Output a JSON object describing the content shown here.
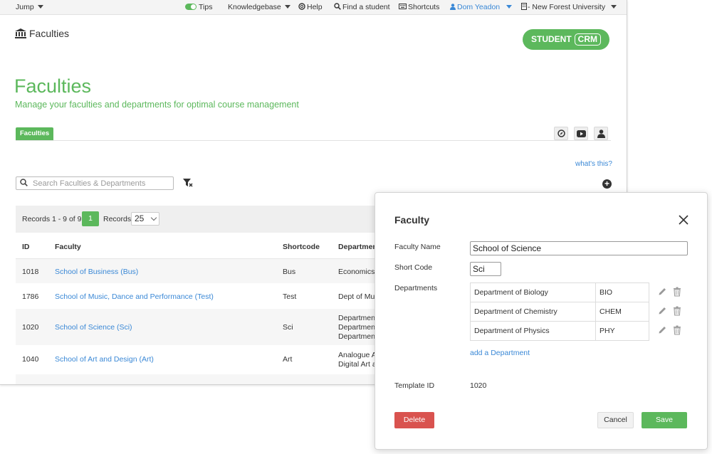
{
  "topbar": {
    "jump": "Jump",
    "tips": "Tips",
    "knowledgebase": "Knowledgebase",
    "help": "Help",
    "find_student": "Find a student",
    "shortcuts": "Shortcuts",
    "user": "Dom Yeadon",
    "institution": "- New Forest University"
  },
  "header": {
    "title": "Faculties"
  },
  "logo": {
    "student": "STUDENT",
    "crm": "CRM"
  },
  "page": {
    "title": "Faculties",
    "subtitle": "Manage your faculties and departments for optimal course management",
    "tab": "Faculties",
    "whats_this": "what's this?"
  },
  "search": {
    "placeholder": "Search Faculties & Departments"
  },
  "pager": {
    "records_text": "Records 1 - 9 of 9",
    "page": "1",
    "records_label": "Records:",
    "per_page": "25"
  },
  "table": {
    "headers": {
      "id": "ID",
      "faculty": "Faculty",
      "shortcode": "Shortcode",
      "departments": "Departmen"
    },
    "rows": [
      {
        "id": "1018",
        "faculty": "School of Business (Bus)",
        "shortcode": "Bus",
        "dept": [
          "Economics"
        ]
      },
      {
        "id": "1786",
        "faculty": "School of Music, Dance and Performance (Test)",
        "shortcode": "Test",
        "dept": [
          "Dept of Mus"
        ]
      },
      {
        "id": "1020",
        "faculty": "School of Science (Sci)",
        "shortcode": "Sci",
        "dept": [
          "Departmen",
          "Departmen",
          "Departmen"
        ]
      },
      {
        "id": "1040",
        "faculty": "School of Art and Design (Art)",
        "shortcode": "Art",
        "dept": [
          "Analogue A",
          "Digital Art a"
        ]
      }
    ]
  },
  "dialog": {
    "title": "Faculty",
    "faculty_name_label": "Faculty Name",
    "faculty_name_value": "School of Science",
    "short_code_label": "Short Code",
    "short_code_value": "Sci",
    "departments_label": "Departments",
    "departments": [
      {
        "name": "Department of Biology",
        "code": "BIO"
      },
      {
        "name": "Department of Chemistry",
        "code": "CHEM"
      },
      {
        "name": "Department of Physics",
        "code": "PHY"
      }
    ],
    "add_department": "add a Department",
    "template_id_label": "Template ID",
    "template_id_value": "1020",
    "delete": "Delete",
    "cancel": "Cancel",
    "save": "Save"
  },
  "colors": {
    "brand_green": "#5cb85c",
    "link_blue": "#3a88d6",
    "danger_red": "#d9534f"
  }
}
